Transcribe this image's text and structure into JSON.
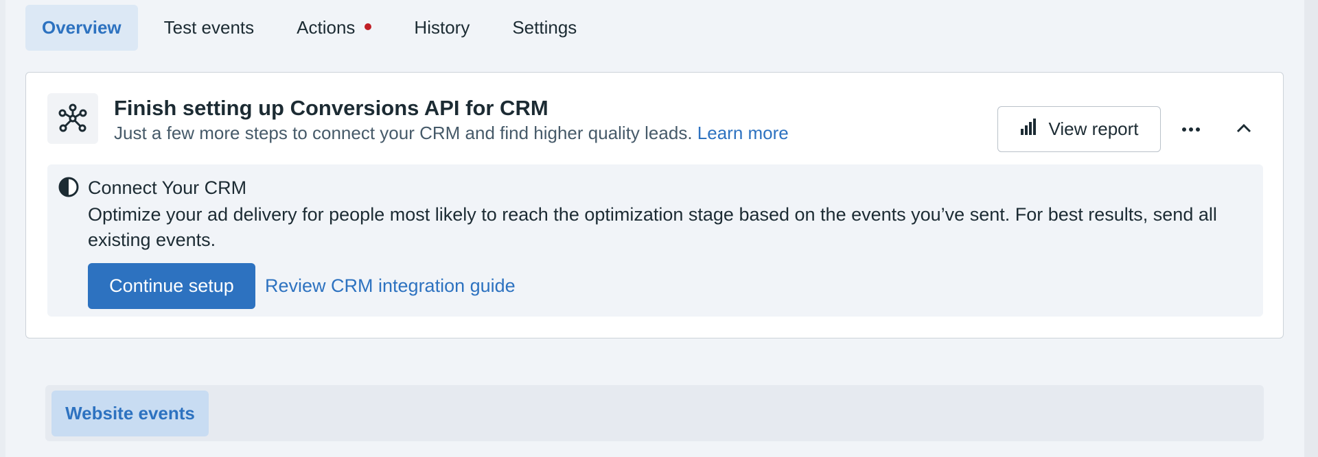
{
  "tabs": [
    {
      "label": "Overview",
      "active": true
    },
    {
      "label": "Test events",
      "active": false
    },
    {
      "label": "Actions",
      "active": false,
      "badge": "red-dot"
    },
    {
      "label": "History",
      "active": false
    },
    {
      "label": "Settings",
      "active": false
    }
  ],
  "card": {
    "icon": "network-nodes-icon",
    "title": "Finish setting up Conversions API for CRM",
    "subtitle": "Just a few more steps to connect your CRM and find higher quality leads.",
    "subtitle_link": "Learn more",
    "view_report_label": "View report",
    "view_report_icon": "bar-chart-icon",
    "more_icon": "more-horizontal-icon",
    "collapse_icon": "chevron-up-icon",
    "step": {
      "icon": "half-circle-progress-icon",
      "title": "Connect Your CRM",
      "description": "Optimize your ad delivery for people most likely to reach the optimization stage based on the events you’ve sent. For best results, send all existing events.",
      "primary_button": "Continue setup",
      "secondary_link": "Review CRM integration guide"
    }
  },
  "events_section": {
    "tab_label": "Website events"
  },
  "colors": {
    "accent": "#2d72c0",
    "active_tab_bg": "#dce8f5",
    "badge_dot": "#c01f26",
    "page_bg": "#f1f4f8"
  }
}
